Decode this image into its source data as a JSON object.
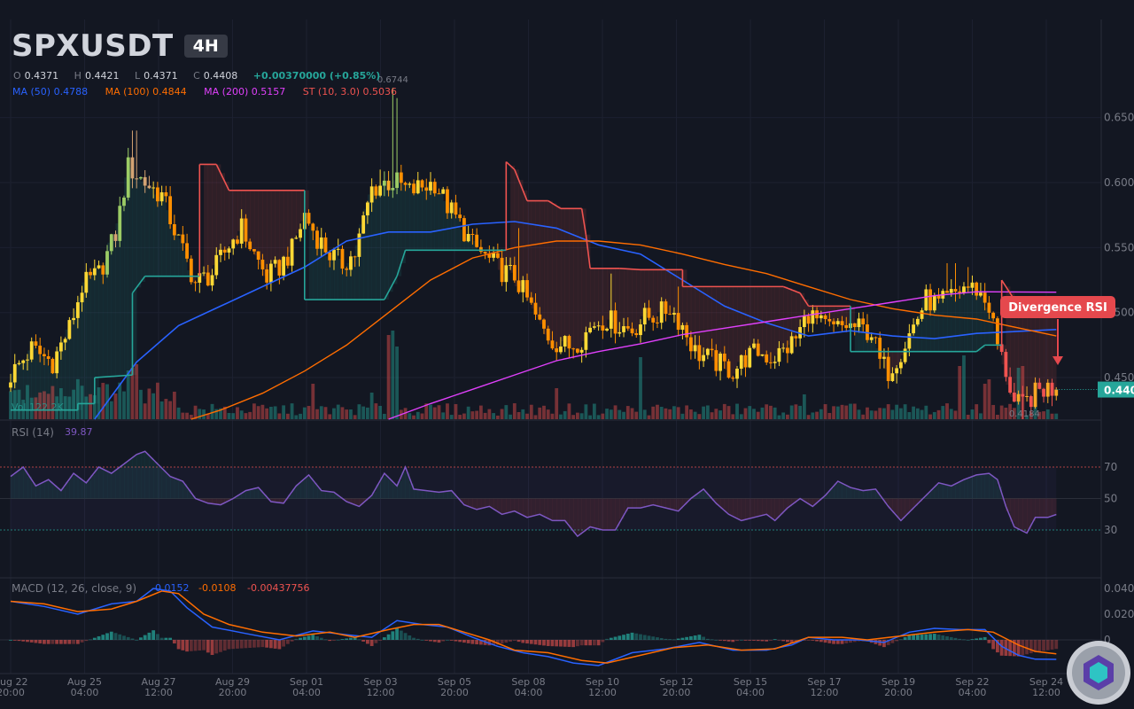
{
  "header": {
    "symbol": "SPXUSDT",
    "timeframe": "4H",
    "ohlc": {
      "o_label": "O",
      "o": "0.4371",
      "h_label": "H",
      "h": "0.4421",
      "l_label": "L",
      "l": "0.4371",
      "c_label": "C",
      "c": "0.4408",
      "change": "+0.00370000 (+0.85%)"
    },
    "indicators": [
      {
        "text": "MA (50)  0.4788",
        "color": "#2962ff"
      },
      {
        "text": "MA (100)  0.4844",
        "color": "#ff6d00"
      },
      {
        "text": "MA (200)  0.5157",
        "color": "#e040fb"
      },
      {
        "text": "ST (10, 3.0)  0.5036",
        "color": "#ef5350"
      }
    ]
  },
  "price_pane": {
    "high_marker": "0.6744",
    "low_marker": "0.4184",
    "last_price_label": "0.4408",
    "last_price_color": "#26a69a",
    "volume_label": "Vol  122.2K",
    "annotation": "Divergence RSI",
    "annotation_color": "#e5484d",
    "y_ticks": [
      "0.450",
      "0.500",
      "0.550",
      "0.600",
      "0.650"
    ]
  },
  "rsi_pane": {
    "title": "RSI (14)",
    "value": "39.87",
    "ticks": [
      "30",
      "50",
      "70"
    ]
  },
  "macd_pane": {
    "title": "MACD (12, 26, close, 9)",
    "macd_value": "-0.0152",
    "signal_value": "-0.0108",
    "hist_value": "-0.00437756",
    "ticks": [
      "0",
      "0.020",
      "0.040"
    ]
  },
  "x_axis": [
    {
      "l1": "Aug 22",
      "l2": "20:00"
    },
    {
      "l1": "Aug 25",
      "l2": "04:00"
    },
    {
      "l1": "Aug 27",
      "l2": "12:00"
    },
    {
      "l1": "Aug 29",
      "l2": "20:00"
    },
    {
      "l1": "Sep 01",
      "l2": "04:00"
    },
    {
      "l1": "Sep 03",
      "l2": "12:00"
    },
    {
      "l1": "Sep 05",
      "l2": "20:00"
    },
    {
      "l1": "Sep 08",
      "l2": "04:00"
    },
    {
      "l1": "Sep 10",
      "l2": "12:00"
    },
    {
      "l1": "Sep 12",
      "l2": "20:00"
    },
    {
      "l1": "Sep 15",
      "l2": "04:00"
    },
    {
      "l1": "Sep 17",
      "l2": "12:00"
    },
    {
      "l1": "Sep 19",
      "l2": "20:00"
    },
    {
      "l1": "Sep 22",
      "l2": "04:00"
    },
    {
      "l1": "Sep 24",
      "l2": "12:00"
    }
  ],
  "chart_data": {
    "type": "candlestick",
    "ylim": [
      0.418,
      0.675
    ],
    "close_path": [
      [
        0,
        0.452
      ],
      [
        5,
        0.472
      ],
      [
        10,
        0.462
      ],
      [
        14,
        0.488
      ],
      [
        17,
        0.52
      ],
      [
        21,
        0.53
      ],
      [
        25,
        0.56
      ],
      [
        28,
        0.612
      ],
      [
        32,
        0.6
      ],
      [
        36,
        0.59
      ],
      [
        40,
        0.555
      ],
      [
        44,
        0.523
      ],
      [
        48,
        0.53
      ],
      [
        52,
        0.552
      ],
      [
        55,
        0.565
      ],
      [
        58,
        0.545
      ],
      [
        61,
        0.527
      ],
      [
        64,
        0.535
      ],
      [
        67,
        0.548
      ],
      [
        70,
        0.575
      ],
      [
        73,
        0.558
      ],
      [
        76,
        0.545
      ],
      [
        79,
        0.538
      ],
      [
        82,
        0.545
      ],
      [
        86,
        0.595
      ],
      [
        89,
        0.6
      ],
      [
        92,
        0.6
      ],
      [
        95,
        0.593
      ],
      [
        98,
        0.597
      ],
      [
        101,
        0.6
      ],
      [
        104,
        0.582
      ],
      [
        107,
        0.568
      ],
      [
        110,
        0.552
      ],
      [
        114,
        0.54
      ],
      [
        117,
        0.532
      ],
      [
        120,
        0.528
      ],
      [
        123,
        0.51
      ],
      [
        126,
        0.49
      ],
      [
        129,
        0.478
      ],
      [
        133,
        0.474
      ],
      [
        136,
        0.48
      ],
      [
        139,
        0.492
      ],
      [
        142,
        0.495
      ],
      [
        145,
        0.49
      ],
      [
        148,
        0.487
      ],
      [
        151,
        0.496
      ],
      [
        154,
        0.498
      ],
      [
        157,
        0.504
      ],
      [
        160,
        0.49
      ],
      [
        163,
        0.47
      ],
      [
        166,
        0.465
      ],
      [
        169,
        0.46
      ],
      [
        172,
        0.455
      ],
      [
        175,
        0.465
      ],
      [
        178,
        0.47
      ],
      [
        181,
        0.465
      ],
      [
        184,
        0.47
      ],
      [
        187,
        0.48
      ],
      [
        190,
        0.5
      ],
      [
        193,
        0.49
      ],
      [
        196,
        0.487
      ],
      [
        199,
        0.49
      ],
      [
        202,
        0.488
      ],
      [
        205,
        0.485
      ],
      [
        207,
        0.462
      ],
      [
        209,
        0.455
      ],
      [
        212,
        0.47
      ],
      [
        215,
        0.49
      ],
      [
        218,
        0.51
      ],
      [
        221,
        0.506
      ],
      [
        224,
        0.512
      ],
      [
        227,
        0.52
      ],
      [
        230,
        0.518
      ],
      [
        233,
        0.505
      ],
      [
        235,
        0.475
      ],
      [
        237,
        0.455
      ],
      [
        239,
        0.43
      ],
      [
        241,
        0.428
      ],
      [
        243,
        0.435
      ],
      [
        245,
        0.44
      ],
      [
        247,
        0.442
      ],
      [
        249,
        0.44
      ]
    ],
    "wick_spikes": [
      [
        29,
        0.64
      ],
      [
        30,
        0.64
      ],
      [
        88,
        0.61
      ],
      [
        91,
        0.673
      ],
      [
        92,
        0.665
      ],
      [
        121,
        0.565
      ],
      [
        143,
        0.53
      ],
      [
        159,
        0.52
      ],
      [
        183,
        0.478
      ],
      [
        195,
        0.5
      ],
      [
        223,
        0.538
      ],
      [
        225,
        0.538
      ],
      [
        228,
        0.535
      ],
      [
        237,
        0.472
      ],
      [
        241,
        0.418
      ]
    ],
    "ma50": [
      [
        20,
        0.418
      ],
      [
        30,
        0.462
      ],
      [
        40,
        0.49
      ],
      [
        50,
        0.505
      ],
      [
        60,
        0.52
      ],
      [
        70,
        0.535
      ],
      [
        80,
        0.555
      ],
      [
        90,
        0.562
      ],
      [
        100,
        0.562
      ],
      [
        110,
        0.568
      ],
      [
        120,
        0.57
      ],
      [
        130,
        0.565
      ],
      [
        140,
        0.552
      ],
      [
        150,
        0.545
      ],
      [
        160,
        0.525
      ],
      [
        170,
        0.505
      ],
      [
        180,
        0.492
      ],
      [
        190,
        0.482
      ],
      [
        200,
        0.486
      ],
      [
        210,
        0.482
      ],
      [
        220,
        0.48
      ],
      [
        230,
        0.484
      ],
      [
        249,
        0.487
      ]
    ],
    "ma100": [
      [
        43,
        0.418
      ],
      [
        50,
        0.425
      ],
      [
        60,
        0.438
      ],
      [
        70,
        0.455
      ],
      [
        80,
        0.475
      ],
      [
        90,
        0.5
      ],
      [
        100,
        0.525
      ],
      [
        110,
        0.542
      ],
      [
        120,
        0.55
      ],
      [
        130,
        0.555
      ],
      [
        140,
        0.555
      ],
      [
        150,
        0.552
      ],
      [
        160,
        0.545
      ],
      [
        170,
        0.537
      ],
      [
        180,
        0.53
      ],
      [
        190,
        0.52
      ],
      [
        200,
        0.51
      ],
      [
        210,
        0.503
      ],
      [
        220,
        0.498
      ],
      [
        230,
        0.495
      ],
      [
        249,
        0.482
      ]
    ],
    "ma200": [
      [
        90,
        0.418
      ],
      [
        100,
        0.43
      ],
      [
        110,
        0.441
      ],
      [
        120,
        0.452
      ],
      [
        130,
        0.463
      ],
      [
        140,
        0.47
      ],
      [
        150,
        0.476
      ],
      [
        160,
        0.483
      ],
      [
        170,
        0.488
      ],
      [
        180,
        0.493
      ],
      [
        190,
        0.498
      ],
      [
        200,
        0.503
      ],
      [
        210,
        0.508
      ],
      [
        220,
        0.513
      ],
      [
        230,
        0.516
      ],
      [
        249,
        0.5157
      ]
    ],
    "supertrend": [
      [
        0,
        0.425
      ],
      [
        16,
        0.425
      ],
      [
        16,
        0.43
      ],
      [
        20,
        0.43
      ],
      [
        20,
        0.45
      ],
      [
        29,
        0.452
      ],
      [
        29,
        0.515
      ],
      [
        32,
        0.528
      ],
      [
        45,
        0.528
      ],
      [
        45,
        0.614
      ],
      [
        49,
        0.614
      ],
      [
        52,
        0.594
      ],
      [
        70,
        0.594
      ],
      [
        70,
        0.51
      ],
      [
        89,
        0.51
      ],
      [
        92,
        0.528
      ],
      [
        94,
        0.548
      ],
      [
        118,
        0.548
      ],
      [
        118,
        0.616
      ],
      [
        120,
        0.61
      ],
      [
        123,
        0.586
      ],
      [
        128,
        0.586
      ],
      [
        131,
        0.58
      ],
      [
        136,
        0.58
      ],
      [
        137,
        0.56
      ],
      [
        138,
        0.534
      ],
      [
        145,
        0.534
      ],
      [
        150,
        0.533
      ],
      [
        160,
        0.533
      ],
      [
        160,
        0.52
      ],
      [
        184,
        0.52
      ],
      [
        188,
        0.515
      ],
      [
        190,
        0.505
      ],
      [
        200,
        0.505
      ],
      [
        200,
        0.47
      ],
      [
        230,
        0.47
      ],
      [
        232,
        0.475
      ],
      [
        236,
        0.475
      ],
      [
        236,
        0.525
      ],
      [
        240,
        0.505
      ],
      [
        249,
        0.505
      ]
    ],
    "rsi": [
      [
        0,
        64
      ],
      [
        3,
        70
      ],
      [
        6,
        58
      ],
      [
        9,
        62
      ],
      [
        12,
        55
      ],
      [
        15,
        66
      ],
      [
        18,
        60
      ],
      [
        21,
        70
      ],
      [
        24,
        66
      ],
      [
        27,
        72
      ],
      [
        30,
        78
      ],
      [
        32,
        80
      ],
      [
        35,
        72
      ],
      [
        38,
        64
      ],
      [
        41,
        61
      ],
      [
        44,
        50
      ],
      [
        47,
        47
      ],
      [
        50,
        46
      ],
      [
        53,
        50
      ],
      [
        56,
        55
      ],
      [
        59,
        57
      ],
      [
        62,
        48
      ],
      [
        65,
        47
      ],
      [
        68,
        58
      ],
      [
        71,
        65
      ],
      [
        74,
        55
      ],
      [
        77,
        54
      ],
      [
        80,
        48
      ],
      [
        83,
        45
      ],
      [
        86,
        52
      ],
      [
        89,
        66
      ],
      [
        92,
        58
      ],
      [
        94,
        70
      ],
      [
        96,
        56
      ],
      [
        99,
        55
      ],
      [
        102,
        54
      ],
      [
        105,
        55
      ],
      [
        108,
        46
      ],
      [
        111,
        43
      ],
      [
        114,
        45
      ],
      [
        117,
        40
      ],
      [
        120,
        42
      ],
      [
        123,
        38
      ],
      [
        126,
        40
      ],
      [
        129,
        36
      ],
      [
        132,
        36
      ],
      [
        135,
        26
      ],
      [
        138,
        32
      ],
      [
        141,
        30
      ],
      [
        144,
        30
      ],
      [
        147,
        44
      ],
      [
        150,
        44
      ],
      [
        153,
        46
      ],
      [
        156,
        44
      ],
      [
        159,
        42
      ],
      [
        162,
        50
      ],
      [
        165,
        56
      ],
      [
        168,
        47
      ],
      [
        171,
        40
      ],
      [
        174,
        36
      ],
      [
        177,
        38
      ],
      [
        180,
        40
      ],
      [
        182,
        36
      ],
      [
        185,
        44
      ],
      [
        188,
        50
      ],
      [
        191,
        45
      ],
      [
        194,
        52
      ],
      [
        197,
        61
      ],
      [
        200,
        57
      ],
      [
        203,
        55
      ],
      [
        206,
        56
      ],
      [
        209,
        45
      ],
      [
        212,
        36
      ],
      [
        215,
        44
      ],
      [
        218,
        52
      ],
      [
        221,
        60
      ],
      [
        224,
        58
      ],
      [
        227,
        62
      ],
      [
        230,
        65
      ],
      [
        233,
        66
      ],
      [
        235,
        62
      ],
      [
        237,
        45
      ],
      [
        239,
        32
      ],
      [
        242,
        28
      ],
      [
        244,
        38
      ],
      [
        247,
        38
      ],
      [
        249,
        39.87
      ]
    ],
    "macd_line": [
      [
        0,
        0.03
      ],
      [
        8,
        0.026
      ],
      [
        16,
        0.02
      ],
      [
        24,
        0.028
      ],
      [
        30,
        0.03
      ],
      [
        34,
        0.04
      ],
      [
        38,
        0.038
      ],
      [
        42,
        0.025
      ],
      [
        48,
        0.01
      ],
      [
        56,
        0.005
      ],
      [
        64,
        0.0
      ],
      [
        72,
        0.007
      ],
      [
        80,
        0.004
      ],
      [
        86,
        0.002
      ],
      [
        92,
        0.015
      ],
      [
        98,
        0.012
      ],
      [
        104,
        0.01
      ],
      [
        110,
        0.002
      ],
      [
        116,
        -0.005
      ],
      [
        122,
        -0.01
      ],
      [
        128,
        -0.013
      ],
      [
        134,
        -0.018
      ],
      [
        140,
        -0.02
      ],
      [
        148,
        -0.01
      ],
      [
        156,
        -0.007
      ],
      [
        164,
        -0.002
      ],
      [
        172,
        -0.008
      ],
      [
        180,
        -0.008
      ],
      [
        186,
        -0.004
      ],
      [
        190,
        0.002
      ],
      [
        196,
        0.0
      ],
      [
        202,
        0.0
      ],
      [
        208,
        -0.002
      ],
      [
        214,
        0.006
      ],
      [
        220,
        0.009
      ],
      [
        226,
        0.008
      ],
      [
        232,
        0.008
      ],
      [
        236,
        -0.005
      ],
      [
        240,
        -0.012
      ],
      [
        244,
        -0.015
      ],
      [
        249,
        -0.0152
      ]
    ],
    "signal_line": [
      [
        0,
        0.03
      ],
      [
        8,
        0.028
      ],
      [
        16,
        0.022
      ],
      [
        24,
        0.024
      ],
      [
        30,
        0.03
      ],
      [
        36,
        0.038
      ],
      [
        40,
        0.036
      ],
      [
        46,
        0.02
      ],
      [
        52,
        0.012
      ],
      [
        60,
        0.006
      ],
      [
        68,
        0.003
      ],
      [
        76,
        0.006
      ],
      [
        82,
        0.002
      ],
      [
        90,
        0.008
      ],
      [
        96,
        0.012
      ],
      [
        102,
        0.012
      ],
      [
        108,
        0.006
      ],
      [
        114,
        0.0
      ],
      [
        120,
        -0.008
      ],
      [
        128,
        -0.01
      ],
      [
        136,
        -0.016
      ],
      [
        142,
        -0.018
      ],
      [
        150,
        -0.012
      ],
      [
        158,
        -0.006
      ],
      [
        166,
        -0.004
      ],
      [
        174,
        -0.008
      ],
      [
        182,
        -0.007
      ],
      [
        190,
        0.002
      ],
      [
        198,
        0.002
      ],
      [
        204,
        0.0
      ],
      [
        212,
        0.003
      ],
      [
        220,
        0.006
      ],
      [
        228,
        0.008
      ],
      [
        234,
        0.006
      ],
      [
        240,
        -0.004
      ],
      [
        244,
        -0.009
      ],
      [
        249,
        -0.0108
      ]
    ]
  }
}
